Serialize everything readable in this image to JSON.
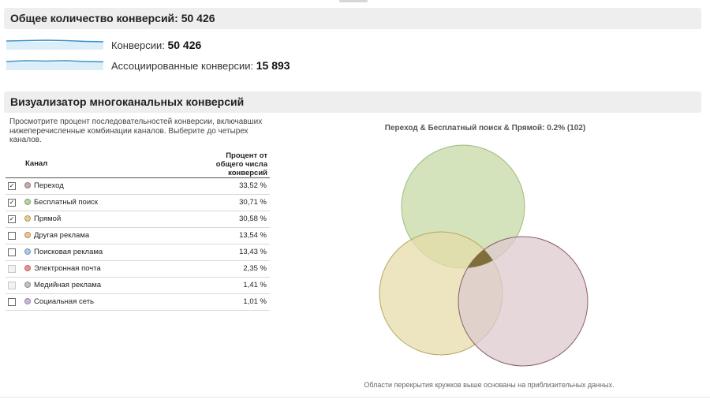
{
  "summary": {
    "header": "Общее количество конверсий: 50 426",
    "metrics": [
      {
        "label": "Конверсии:",
        "value": "50 426"
      },
      {
        "label": "Ассоциированные конверсии:",
        "value": "15 893"
      }
    ]
  },
  "visualizer": {
    "header": "Визуализатор многоканальных конверсий",
    "description": "Просмотрите процент последовательностей конверсии, включавших нижеперечисленные комбинации каналов. Выберите до четырех каналов.",
    "table": {
      "col_channel": "Канал",
      "col_percent": "Процент от общего числа конверсий",
      "rows": [
        {
          "name": "Переход",
          "value": "33,52 %",
          "checked": true,
          "enabled": true,
          "color": "#c9a9a9"
        },
        {
          "name": "Бесплатный поиск",
          "value": "30,71 %",
          "checked": true,
          "enabled": true,
          "color": "#b5d59a"
        },
        {
          "name": "Прямой",
          "value": "30,58 %",
          "checked": true,
          "enabled": true,
          "color": "#e6d18a"
        },
        {
          "name": "Другая реклама",
          "value": "13,54 %",
          "checked": false,
          "enabled": true,
          "color": "#f3c28a"
        },
        {
          "name": "Поисковая реклама",
          "value": "13,43 %",
          "checked": false,
          "enabled": true,
          "color": "#a9c7ef"
        },
        {
          "name": "Электронная почта",
          "value": "2,35 %",
          "checked": false,
          "enabled": false,
          "color": "#f09090"
        },
        {
          "name": "Медийная реклама",
          "value": "1,41 %",
          "checked": false,
          "enabled": false,
          "color": "#c2c2c2"
        },
        {
          "name": "Социальная сеть",
          "value": "1,01 %",
          "checked": false,
          "enabled": true,
          "color": "#c9b6e0"
        }
      ]
    },
    "venn": {
      "title": "Переход & Бесплатный поиск & Прямой: 0.2% (102)",
      "note": "Области перекрытия кружков выше основаны на приблизительных данных.",
      "circles": [
        {
          "channel": "Бесплатный поиск",
          "fill": "#cfe0b4",
          "stroke": "#9fba80"
        },
        {
          "channel": "Прямой",
          "fill": "#e5dcaa",
          "stroke": "#b8a760"
        },
        {
          "channel": "Переход",
          "fill": "#ddc9cf",
          "stroke": "#8c5e6a"
        }
      ],
      "intersection_color": "#7e6f3a"
    }
  }
}
